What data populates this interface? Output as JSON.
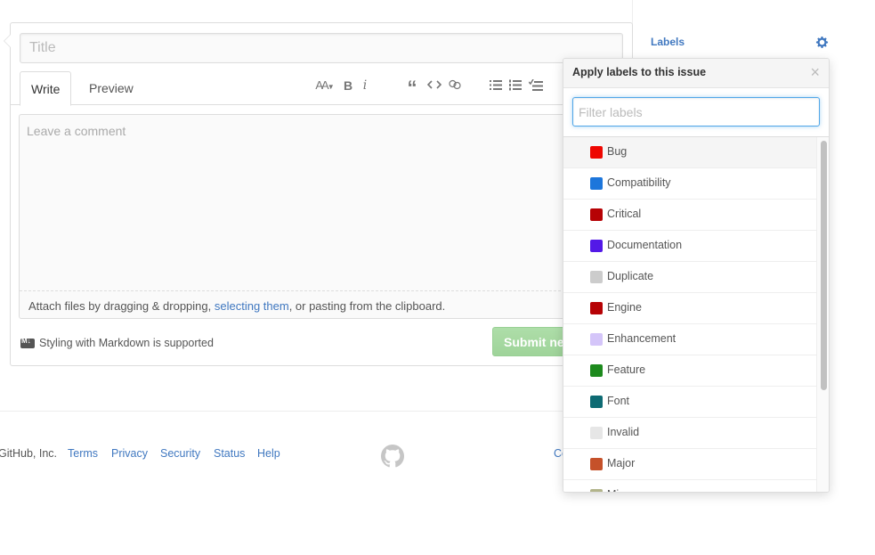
{
  "issue_form": {
    "title_placeholder": "Title",
    "tabs": [
      {
        "label": "Write",
        "active": true
      },
      {
        "label": "Preview",
        "active": false
      }
    ],
    "toolbar": [
      {
        "name": "text-size-icon",
        "glyph": "AA▾"
      },
      {
        "name": "bold-icon",
        "glyph": "B"
      },
      {
        "name": "italic-icon",
        "glyph": "i"
      },
      {
        "name": "quote-icon",
        "glyph": "“"
      },
      {
        "name": "code-icon",
        "glyph": "<>"
      },
      {
        "name": "link-icon",
        "glyph": "link"
      },
      {
        "name": "unordered-list-icon",
        "glyph": "ul"
      },
      {
        "name": "ordered-list-icon",
        "glyph": "ol"
      },
      {
        "name": "task-list-icon",
        "glyph": "tasks"
      }
    ],
    "comment_placeholder": "Leave a comment",
    "attach": {
      "before": "Attach files by dragging & dropping, ",
      "link": "selecting them",
      "after": ", or pasting from the clipboard."
    },
    "markdown_note": "Styling with Markdown is supported",
    "submit_label": "Submit new issue"
  },
  "footer": {
    "copyright": "GitHub, Inc.",
    "links": [
      "Terms",
      "Privacy",
      "Security",
      "Status",
      "Help"
    ],
    "right_partial": "Co"
  },
  "sidebar": {
    "labels_heading": "Labels"
  },
  "label_popover": {
    "title": "Apply labels to this issue",
    "close_glyph": "×",
    "filter_placeholder": "Filter labels",
    "labels": [
      {
        "name": "Bug",
        "color": "#ee0701"
      },
      {
        "name": "Compatibility",
        "color": "#1d76db"
      },
      {
        "name": "Critical",
        "color": "#b60205"
      },
      {
        "name": "Documentation",
        "color": "#5319e7"
      },
      {
        "name": "Duplicate",
        "color": "#cccccc"
      },
      {
        "name": "Engine",
        "color": "#b60205"
      },
      {
        "name": "Enhancement",
        "color": "#d4c5f9"
      },
      {
        "name": "Feature",
        "color": "#1d8a1d"
      },
      {
        "name": "Font",
        "color": "#0e6b73"
      },
      {
        "name": "Invalid",
        "color": "#e6e6e6"
      },
      {
        "name": "Major",
        "color": "#c5512a"
      },
      {
        "name": "Minor",
        "color": "#b2b48a"
      }
    ],
    "hovered_index": 0
  }
}
